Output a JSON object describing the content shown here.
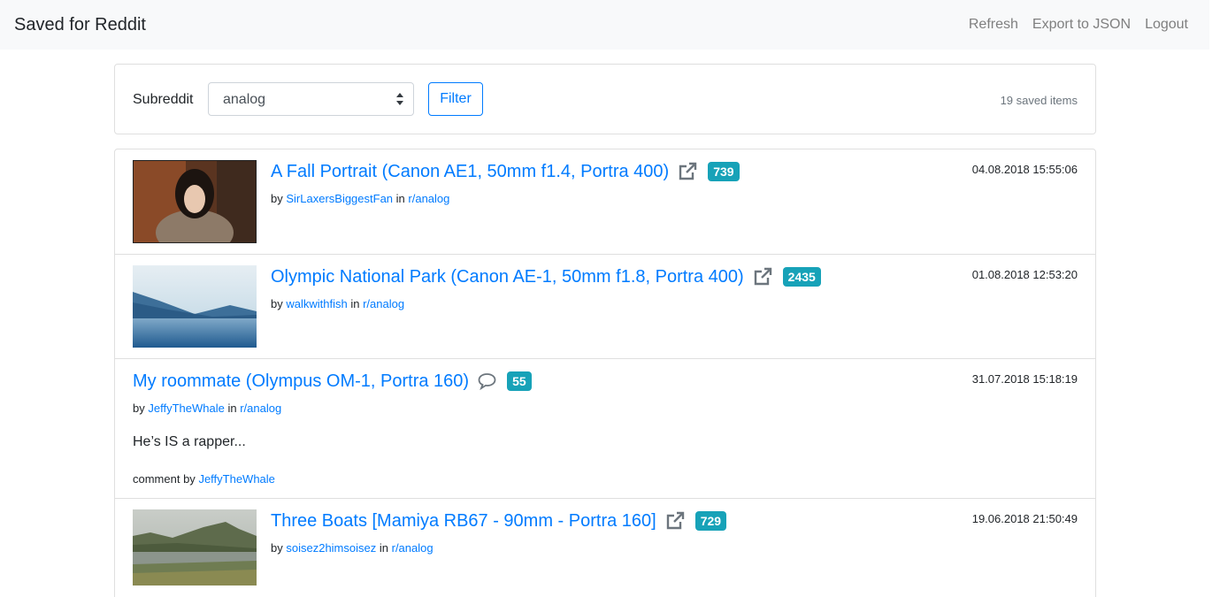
{
  "app": {
    "title": "Saved for Reddit"
  },
  "nav": {
    "refresh": "Refresh",
    "export": "Export to JSON",
    "logout": "Logout"
  },
  "filter": {
    "label": "Subreddit",
    "selected": "analog",
    "button": "Filter",
    "count_text": "19 saved items"
  },
  "colors": {
    "accent": "#007bff",
    "badge": "#17a2b8",
    "muted": "#6c757d"
  },
  "items": [
    {
      "title": "A Fall Portrait (Canon AE1, 50mm f1.4, Portra 400)",
      "icon": "external-link-icon",
      "score": "739",
      "by": "by",
      "author": "SirLaxersBiggestFan",
      "in": "in",
      "subreddit": "r/analog",
      "date": "04.08.2018 15:55:06"
    },
    {
      "title": "Olympic National Park (Canon AE-1, 50mm f1.8, Portra 400)",
      "icon": "external-link-icon",
      "score": "2435",
      "by": "by",
      "author": "walkwithfish",
      "in": "in",
      "subreddit": "r/analog",
      "date": "01.08.2018 12:53:20"
    },
    {
      "title": "My roommate (Olympus OM-1, Portra 160)",
      "icon": "comment-icon",
      "score": "55",
      "by": "by",
      "author": "JeffyTheWhale",
      "in": "in",
      "subreddit": "r/analog",
      "date": "31.07.2018 15:18:19",
      "body": "He’s IS a rapper...",
      "comment_prefix": "comment by",
      "comment_author": "JeffyTheWhale"
    },
    {
      "title": "Three Boats [Mamiya RB67 - 90mm - Portra 160]",
      "icon": "external-link-icon",
      "score": "729",
      "by": "by",
      "author": "soisez2himsoisez",
      "in": "in",
      "subreddit": "r/analog",
      "date": "19.06.2018 21:50:49"
    }
  ]
}
